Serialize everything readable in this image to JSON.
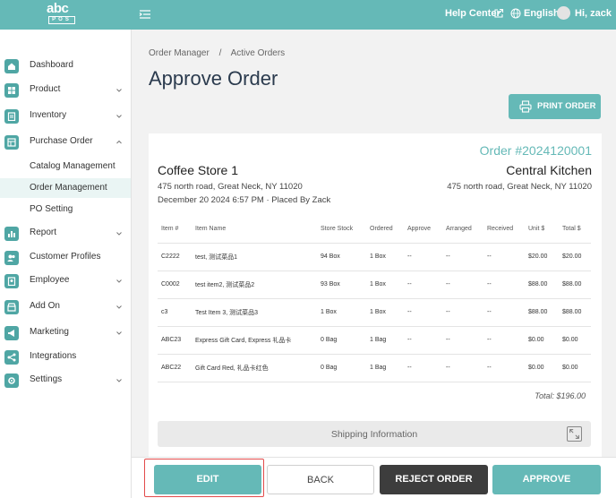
{
  "header": {
    "logo_top": "abc",
    "logo_bottom": "POS",
    "help_label": "Help Center",
    "language": "English",
    "greeting": "Hi, zack",
    "icons": [
      "menu-collapse-icon",
      "external-link-icon",
      "globe-icon",
      "avatar"
    ]
  },
  "sidebar": {
    "items": [
      {
        "label": "Dashboard",
        "icon": "home-icon"
      },
      {
        "label": "Product",
        "icon": "grid-icon"
      },
      {
        "label": "Inventory",
        "icon": "clipboard-icon"
      },
      {
        "label": "Purchase Order",
        "icon": "cart-icon"
      },
      {
        "label": "Report",
        "icon": "bar-chart-icon"
      },
      {
        "label": "Customer Profiles",
        "icon": "users-icon"
      },
      {
        "label": "Employee",
        "icon": "badge-icon"
      },
      {
        "label": "Add On",
        "icon": "store-icon"
      },
      {
        "label": "Marketing",
        "icon": "megaphone-icon"
      },
      {
        "label": "Integrations",
        "icon": "share-icon"
      },
      {
        "label": "Settings",
        "icon": "gear-icon"
      }
    ],
    "sub_items": [
      {
        "label": "Catalog Management"
      },
      {
        "label": "Order Management"
      },
      {
        "label": "PO Setting"
      }
    ]
  },
  "breadcrumb": {
    "root": "Order Manager",
    "separator": "/",
    "current": "Active Orders"
  },
  "page_title": "Approve Order",
  "print_button": "PRINT ORDER",
  "order": {
    "number": "Order #2024120001",
    "store": "Coffee Store 1",
    "store_address": "475 north road, Great Neck, NY 11020",
    "kitchen": "Central Kitchen",
    "kitchen_address": "475 north road, Great Neck, NY 11020",
    "placed": "December 20 2024 6:57 PM · Placed By Zack"
  },
  "table": {
    "headers": [
      "Item #",
      "Item Name",
      "Store Stock",
      "Ordered",
      "Approve",
      "Arranged",
      "Received",
      "Unit $",
      "Total $"
    ],
    "rows": [
      [
        "C2222",
        "test, 测试菜品1",
        "94 Box",
        "1 Box",
        "--",
        "--",
        "--",
        "$20.00",
        "$20.00"
      ],
      [
        "C0002",
        "test item2, 测试菜品2",
        "93 Box",
        "1 Box",
        "--",
        "--",
        "--",
        "$88.00",
        "$88.00"
      ],
      [
        "c3",
        "Test Item 3, 测试菜品3",
        "1 Box",
        "1 Box",
        "--",
        "--",
        "--",
        "$88.00",
        "$88.00"
      ],
      [
        "ABC23",
        "Express Gift Card, Express 礼品卡",
        "0 Bag",
        "1 Bag",
        "--",
        "--",
        "--",
        "$0.00",
        "$0.00"
      ],
      [
        "ABC22",
        "Gift Card Red, 礼品卡红色",
        "0 Bag",
        "1 Bag",
        "--",
        "--",
        "--",
        "$0.00",
        "$0.00"
      ]
    ],
    "total": "Total: $196.00"
  },
  "shipping_label": "Shipping Information",
  "footer": {
    "edit": "EDIT",
    "back": "BACK",
    "reject": "REJECT ORDER",
    "approve": "APPROVE"
  },
  "colors": {
    "accent": "#65b9b7",
    "dark_button": "#3d3d3d",
    "highlight": "#e24b4b"
  }
}
